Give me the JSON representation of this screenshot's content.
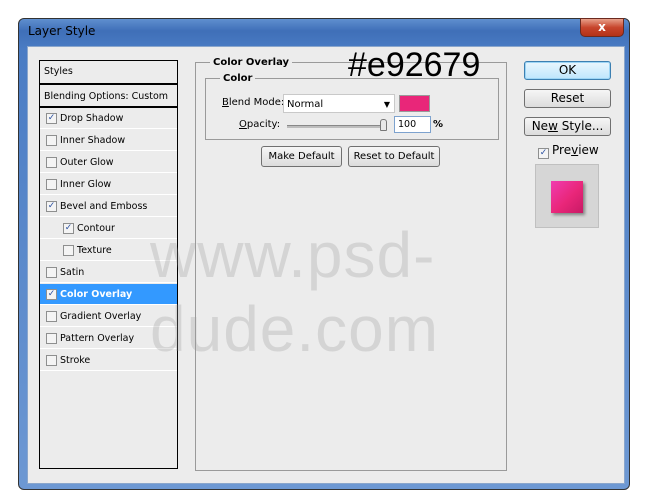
{
  "window": {
    "title": "Layer Style",
    "close_glyph": "x"
  },
  "styles_list": {
    "header": "Styles",
    "blending": "Blending Options: Custom",
    "items": [
      {
        "label": "Drop Shadow",
        "checked": true,
        "indent": false
      },
      {
        "label": "Inner Shadow",
        "checked": false,
        "indent": false
      },
      {
        "label": "Outer Glow",
        "checked": false,
        "indent": false
      },
      {
        "label": "Inner Glow",
        "checked": false,
        "indent": false
      },
      {
        "label": "Bevel and Emboss",
        "checked": true,
        "indent": false
      },
      {
        "label": "Contour",
        "checked": true,
        "indent": true
      },
      {
        "label": "Texture",
        "checked": false,
        "indent": true
      },
      {
        "label": "Satin",
        "checked": false,
        "indent": false
      },
      {
        "label": "Color Overlay",
        "checked": true,
        "indent": false,
        "selected": true
      },
      {
        "label": "Gradient Overlay",
        "checked": false,
        "indent": false
      },
      {
        "label": "Pattern Overlay",
        "checked": false,
        "indent": false
      },
      {
        "label": "Stroke",
        "checked": false,
        "indent": false
      }
    ]
  },
  "panel": {
    "title": "Color Overlay",
    "group": "Color",
    "blend_mode_label_accel": "B",
    "blend_mode_label_rest": "lend Mode:",
    "blend_mode_value": "Normal",
    "opacity_label_accel": "O",
    "opacity_label_rest": "pacity:",
    "opacity_value": "100",
    "opacity_percent": 100,
    "percent_sign": "%",
    "overlay_color": "#e92679",
    "make_default": "Make Default",
    "reset_to_default": "Reset to Default"
  },
  "annotation": "#e92679",
  "watermark": "www.psd-dude.com",
  "buttons": {
    "ok": "OK",
    "reset": "Reset",
    "new_style_a": "Ne",
    "new_style_u": "w",
    "new_style_b": " Style..."
  },
  "preview": {
    "label_a": "Pre",
    "label_u": "v",
    "label_b": "iew",
    "checked": true
  }
}
